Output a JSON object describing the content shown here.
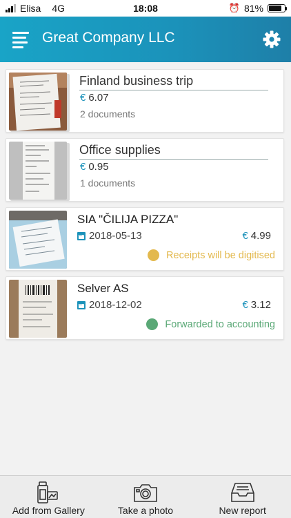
{
  "status_bar": {
    "carrier": "Elisa",
    "network": "4G",
    "time": "18:08",
    "battery": "81%",
    "battery_level": 0.81
  },
  "header": {
    "title": "Great Company LLC",
    "menu_icon": "hamburger-menu-icon",
    "settings_icon": "gear-icon"
  },
  "reports": [
    {
      "title": "Finland business trip",
      "currency": "€",
      "amount": "6.07",
      "documents": "2 documents"
    },
    {
      "title": "Office supplies",
      "currency": "€",
      "amount": "0.95",
      "documents": "1 documents"
    }
  ],
  "receipts": [
    {
      "merchant": "SIA \"ČILIJA PIZZA\"",
      "date": "2018-05-13",
      "currency": "€",
      "amount": "4.99",
      "status": "Receipts will be digitised",
      "status_color": "#e3b94e"
    },
    {
      "merchant": "Selver AS",
      "date": "2018-12-02",
      "currency": "€",
      "amount": "3.12",
      "status": "Forwarded to accounting",
      "status_color": "#5aa876"
    }
  ],
  "bottom_tabs": [
    {
      "label": "Add from Gallery",
      "icon": "gallery-icon"
    },
    {
      "label": "Take a photo",
      "icon": "camera-icon"
    },
    {
      "label": "New report",
      "icon": "inbox-tray-icon"
    }
  ],
  "colors": {
    "accent": "#1b92ba",
    "header_start": "#19a4c7",
    "header_end": "#1e7fa8"
  }
}
